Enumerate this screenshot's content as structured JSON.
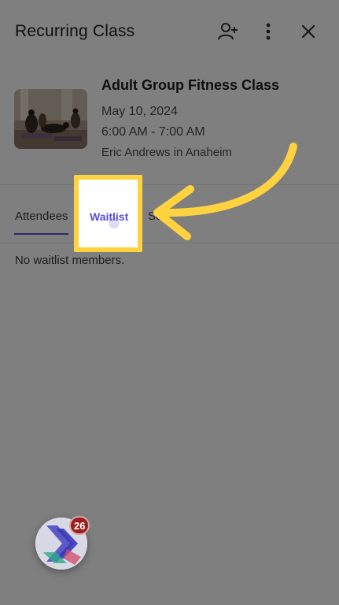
{
  "header": {
    "title": "Recurring Class",
    "add_icon": "person-add-icon",
    "more_icon": "more-vertical-icon",
    "close_icon": "close-icon"
  },
  "class": {
    "name": "Adult Group Fitness Class",
    "date": "May 10, 2024",
    "time": "6:00 AM - 7:00 AM",
    "instructor_location": "Eric Andrews in Anaheim"
  },
  "tabs": [
    {
      "label": "Attendees"
    },
    {
      "label": "Waitlist"
    },
    {
      "label": "Se"
    }
  ],
  "waitlist": {
    "empty_message": "No waitlist members."
  },
  "fab": {
    "badge_count": "26"
  },
  "colors": {
    "accent": "#5b4fd6",
    "highlight": "#ffd23f",
    "badge": "#9b1f1f"
  }
}
